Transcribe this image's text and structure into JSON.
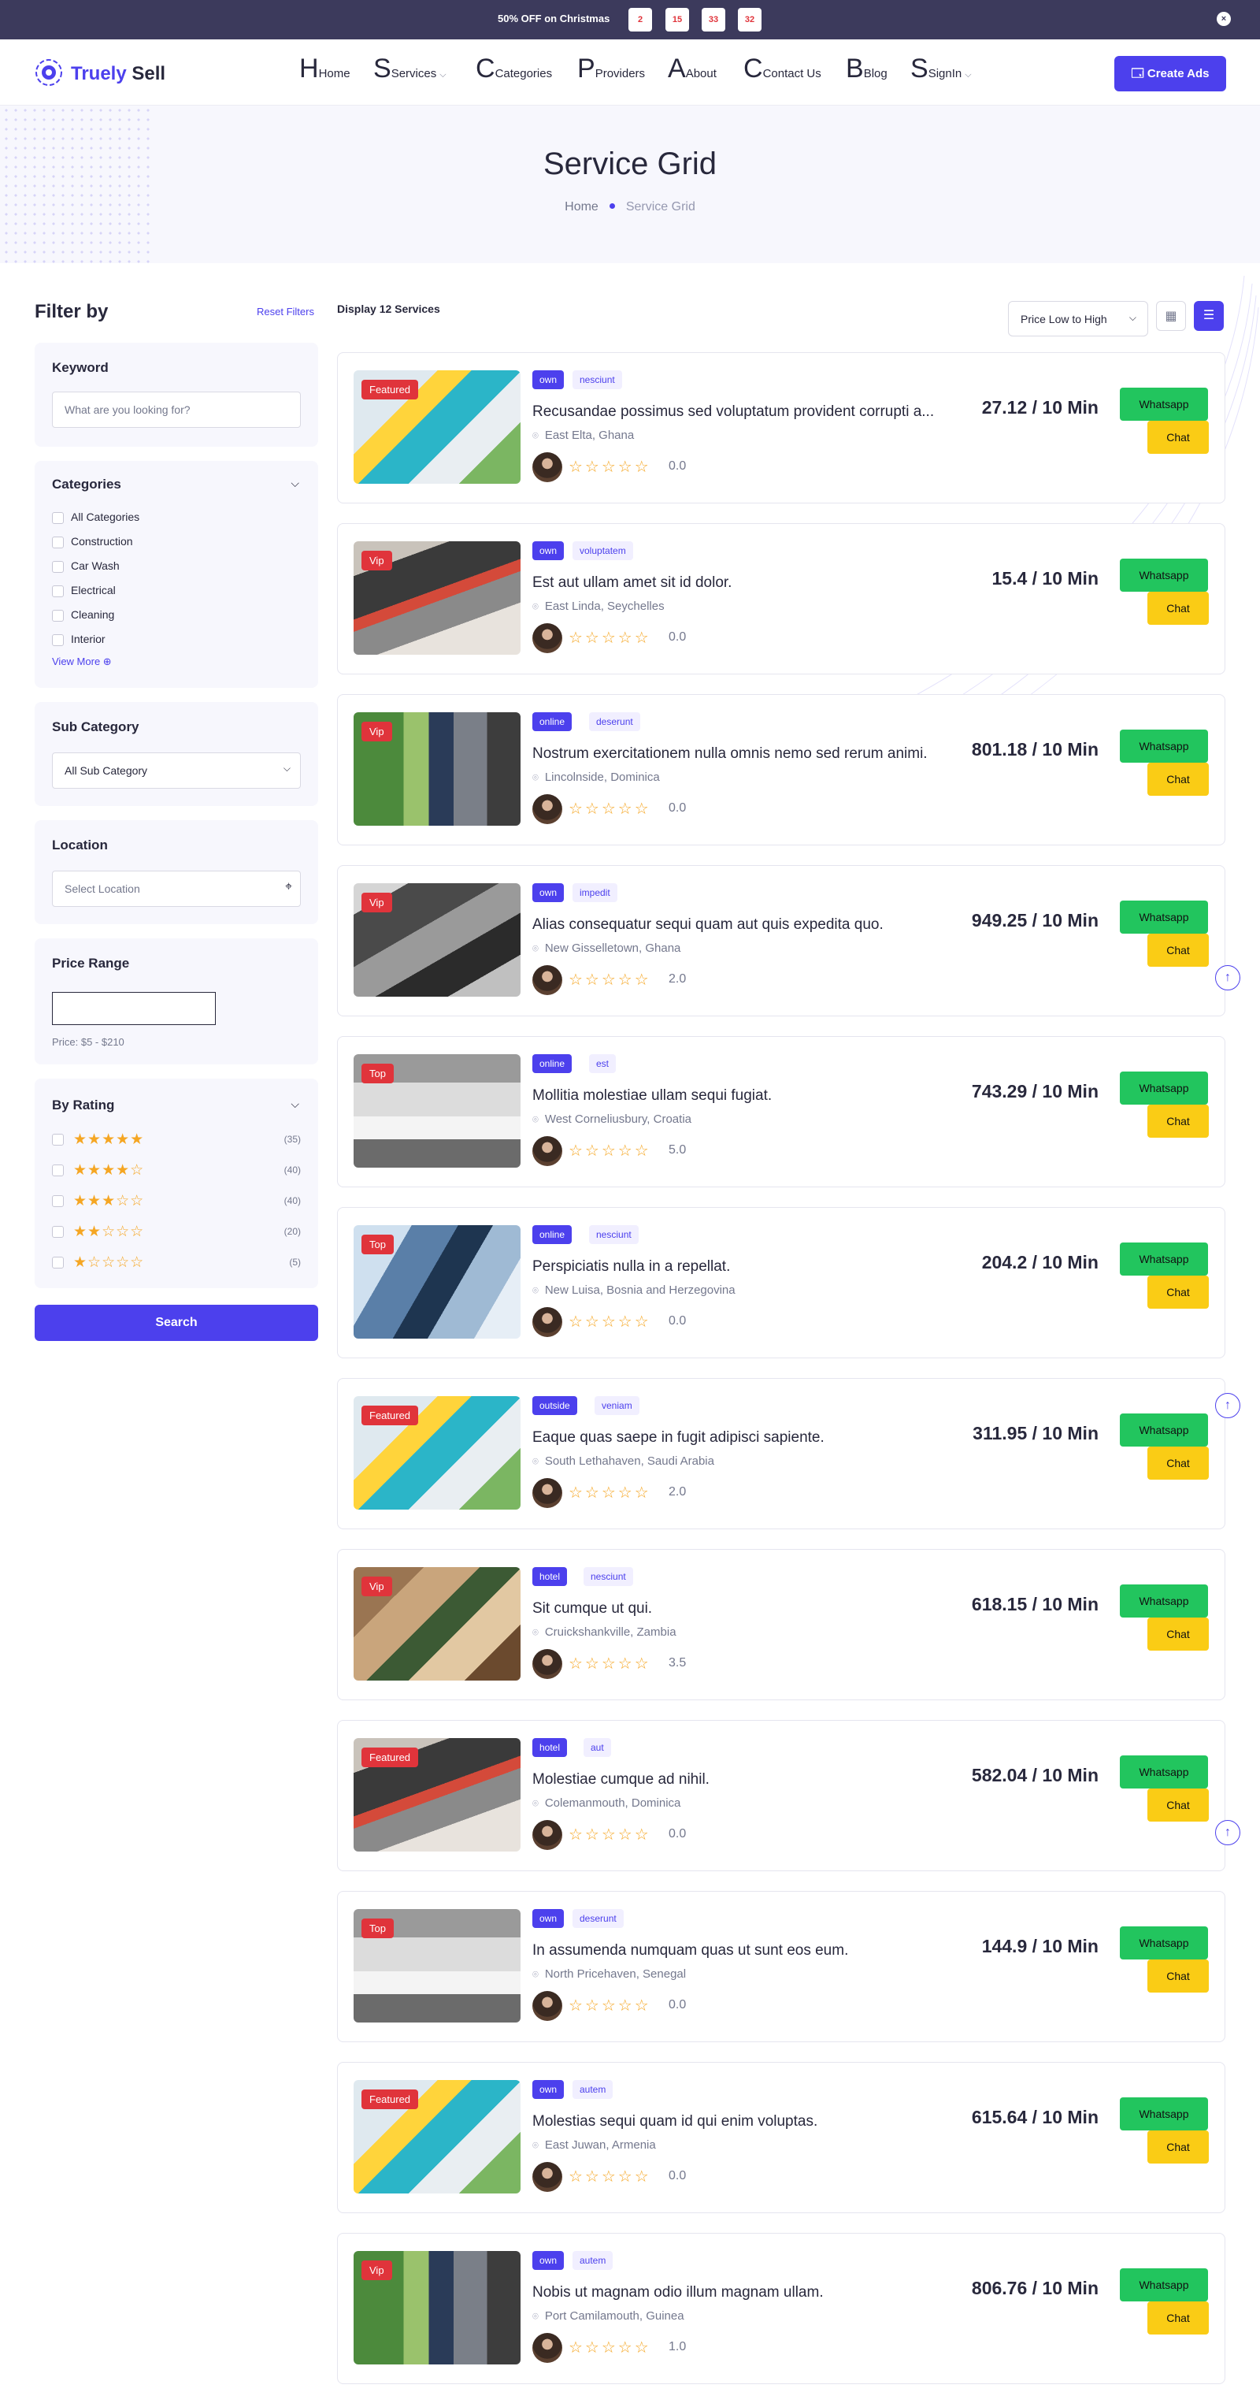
{
  "promo": {
    "text": "50% OFF on Christmas",
    "countdown": [
      "2",
      "15",
      "33",
      "32"
    ],
    "close": "×"
  },
  "brand": {
    "name_part1": "Truely",
    "name_part2": " Sell"
  },
  "nav": [
    {
      "initial": "H",
      "label": "Home",
      "chevron": ""
    },
    {
      "initial": "S",
      "label": "Services",
      "chevron": "⌵"
    },
    {
      "initial": "C",
      "label": "Categories",
      "chevron": ""
    },
    {
      "initial": "P",
      "label": "Providers",
      "chevron": ""
    },
    {
      "initial": "A",
      "label": "About",
      "chevron": ""
    },
    {
      "initial": "C",
      "label": "Contact Us",
      "chevron": ""
    },
    {
      "initial": "B",
      "label": "Blog",
      "chevron": ""
    },
    {
      "initial": "S",
      "label": "SignIn",
      "chevron": "⌵"
    }
  ],
  "create_ads": "🗔 Create Ads",
  "hero": {
    "title": "Service Grid",
    "crumb_home": "Home",
    "crumb_current": "Service Grid"
  },
  "filters": {
    "title": "Filter by",
    "reset": "Reset Filters",
    "keyword": {
      "label": "Keyword",
      "placeholder": "What are you looking for?"
    },
    "categories": {
      "label": "Categories",
      "items": [
        "All Categories",
        "Construction",
        "Car Wash",
        "Electrical",
        "Cleaning",
        "Interior"
      ],
      "view_more": "View More ⊕"
    },
    "sub_category": {
      "label": "Sub Category",
      "value": "All Sub Category"
    },
    "location": {
      "label": "Location",
      "placeholder": "Select Location"
    },
    "price_range": {
      "label": "Price Range",
      "note": "Price: $5 - $210"
    },
    "rating": {
      "label": "By Rating",
      "rows": [
        {
          "stars": 5,
          "count": "(35)"
        },
        {
          "stars": 4,
          "count": "(40)"
        },
        {
          "stars": 3,
          "count": "(40)"
        },
        {
          "stars": 2,
          "count": "(20)"
        },
        {
          "stars": 1,
          "count": "(5)"
        }
      ]
    },
    "search": "Search"
  },
  "results": {
    "count_text": "Display 12 Services",
    "sort": "Price Low to High"
  },
  "services": [
    {
      "badge": "Featured",
      "tag1": "own",
      "tag2": "nesciunt",
      "title": "Recusandae possimus sed voluptatum provident corrupti a...",
      "location": "East Elta, Ghana",
      "rating": "0.0",
      "price": "27.12 / 10 Min",
      "img": "clean"
    },
    {
      "badge": "Vip",
      "tag1": "own",
      "tag2": "voluptatem",
      "title": "Est aut ullam amet sit id dolor.",
      "location": "East Linda, Seychelles",
      "rating": "0.0",
      "price": "15.4 / 10 Min",
      "img": "elec"
    },
    {
      "badge": "Vip",
      "tag1": "online",
      "tag2": "deserunt",
      "title": "Nostrum exercitationem nulla omnis nemo sed rerum animi.",
      "location": "Lincolnside, Dominica",
      "rating": "0.0",
      "price": "801.18 / 10 Min",
      "img": "build"
    },
    {
      "badge": "Vip",
      "tag1": "own",
      "tag2": "impedit",
      "title": "Alias consequatur sequi quam aut quis expedita quo.",
      "location": "New Gisselletown, Ghana",
      "rating": "2.0",
      "price": "949.25 / 10 Min",
      "img": "engine"
    },
    {
      "badge": "Top",
      "tag1": "online",
      "tag2": "est",
      "title": "Mollitia molestiae ullam sequi fugiat.",
      "location": "West Corneliusbury, Croatia",
      "rating": "5.0",
      "price": "743.29 / 10 Min",
      "img": "car"
    },
    {
      "badge": "Top",
      "tag1": "online",
      "tag2": "nesciunt",
      "title": "Perspiciatis nulla in a repellat.",
      "location": "New Luisa, Bosnia and Herzegovina",
      "rating": "0.0",
      "price": "204.2 / 10 Min",
      "img": "tower"
    },
    {
      "badge": "Featured",
      "tag1": "outside",
      "tag2": "veniam",
      "title": "Eaque quas saepe in fugit adipisci sapiente.",
      "location": "South Lethahaven, Saudi Arabia",
      "rating": "2.0",
      "price": "311.95 / 10 Min",
      "img": "clean"
    },
    {
      "badge": "Vip",
      "tag1": "hotel",
      "tag2": "nesciunt",
      "title": "Sit cumque ut qui.",
      "location": "Cruickshankville, Zambia",
      "rating": "3.5",
      "price": "618.15 / 10 Min",
      "img": "wood"
    },
    {
      "badge": "Featured",
      "tag1": "hotel",
      "tag2": "aut",
      "title": "Molestiae cumque ad nihil.",
      "location": "Colemanmouth, Dominica",
      "rating": "0.0",
      "price": "582.04 / 10 Min",
      "img": "elec"
    },
    {
      "badge": "Top",
      "tag1": "own",
      "tag2": "deserunt",
      "title": "In assumenda numquam quas ut sunt eos eum.",
      "location": "North Pricehaven, Senegal",
      "rating": "0.0",
      "price": "144.9 / 10 Min",
      "img": "car"
    },
    {
      "badge": "Featured",
      "tag1": "own",
      "tag2": "autem",
      "title": "Molestias sequi quam id qui enim voluptas.",
      "location": "East Juwan, Armenia",
      "rating": "0.0",
      "price": "615.64 / 10 Min",
      "img": "clean"
    },
    {
      "badge": "Vip",
      "tag1": "own",
      "tag2": "autem",
      "title": "Nobis ut magnam odio illum magnam ullam.",
      "location": "Port Camilamouth, Guinea",
      "rating": "1.0",
      "price": "806.76 / 10 Min",
      "img": "build"
    }
  ],
  "labels": {
    "whatsapp": "Whatsapp",
    "chat": "Chat",
    "stars_empty": "☆☆☆☆☆",
    "up": "↑",
    "pin": "⌾",
    "grid_icon": "▦",
    "list_icon": "☰",
    "chev": "⌵",
    "loc_icon": "⌖"
  },
  "colors": {
    "primary": "#4c40ed",
    "whatsapp": "#22c55e",
    "chat": "#facc15",
    "badge": "#e0343b",
    "star": "#f5a623"
  }
}
